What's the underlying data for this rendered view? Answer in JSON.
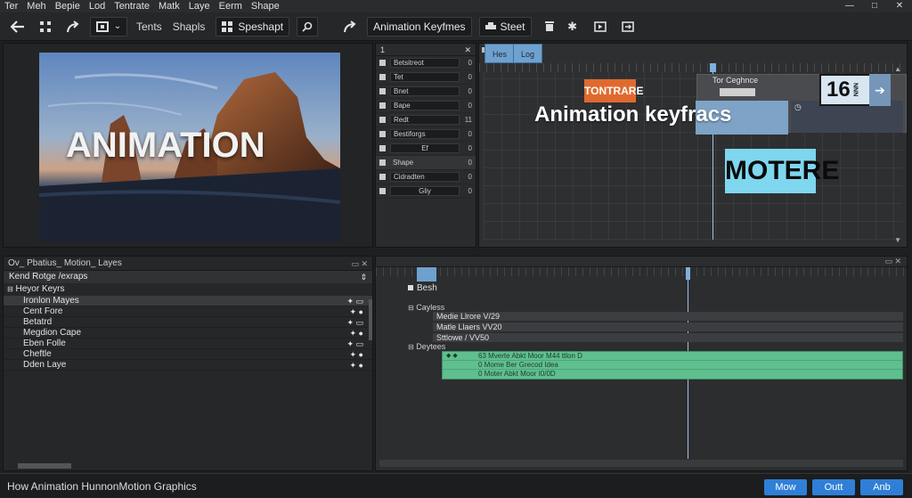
{
  "menu": [
    "Ter",
    "Meh",
    "Bepie",
    "Lod",
    "Tentrate",
    "Matk",
    "Laye",
    "Eerm",
    "Shape"
  ],
  "window_controls": {
    "minimize": "—",
    "maximize": "□",
    "close": "✕"
  },
  "toolbar": {
    "text_items": [
      "Tents",
      "Shapls"
    ],
    "speshapt_label": "Speshapt",
    "animation_keyframes_label": "Animation Keyfmes",
    "steet_label": "Steet"
  },
  "viewer": {
    "title_text": "ANIMATION"
  },
  "properties_panel": {
    "index": "1",
    "close": "✕",
    "rows": [
      {
        "label": "Betsitreot",
        "value": "0"
      },
      {
        "label": "Tet",
        "value": "0"
      },
      {
        "label": "Bnet",
        "value": "0"
      },
      {
        "label": "Bape",
        "value": "0"
      },
      {
        "label": "Redt",
        "value": "11"
      },
      {
        "label": "Bestiforgs",
        "value": "0"
      },
      {
        "label": "Ef",
        "value": "0"
      },
      {
        "label": "Shape",
        "value": "0"
      },
      {
        "label": "Cidradten",
        "value": "0"
      },
      {
        "label": "Gliy",
        "value": "0"
      }
    ]
  },
  "timeline_top": {
    "tabs": [
      "Hes",
      "Log"
    ],
    "headline": "Animation keyfracs",
    "orange_tag": "TONTRARE",
    "toggle_label": "Tor Ceghnce",
    "counter": "16",
    "counter_sub": "NNN",
    "motere_tag": "MOTERE"
  },
  "layers_panel": {
    "header": "Ov_ Pbatius_ Motion_ Layes",
    "section_1": "Kend Rotge /exraps",
    "section_2": "Heyor Keyrs",
    "items": [
      "Ironlon Mayes",
      "Cent Fore",
      "Betatrd",
      "Megdion Cape",
      "Eben Folle",
      "Cheftle",
      "Dden Laye"
    ]
  },
  "timeline_bottom": {
    "row1": "Besh",
    "group1": "Cayless",
    "g1_items": [
      "Medie Llrore V/29",
      "Matle Llaers VV20",
      "Sttlowe / VV50"
    ],
    "group2": "Deytees",
    "track_lines": [
      "63 Mverte Abkt Moor M44 ttlon D",
      "0 Mome Ber Grecod Idea",
      "0 Moter Abkt Moor I0/0D"
    ]
  },
  "status": {
    "text": "How Animation HunnonMotion Graphics"
  },
  "bottom_buttons": [
    "Mow",
    "Outt",
    "Anb"
  ]
}
